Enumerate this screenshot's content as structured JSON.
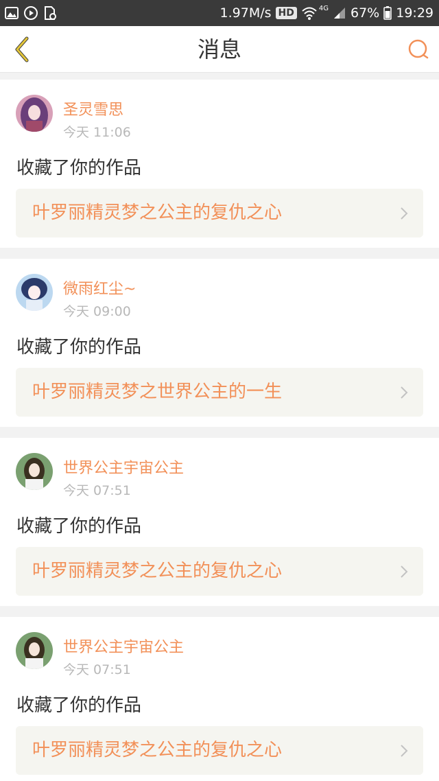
{
  "status_bar": {
    "speed": "1.97M/s",
    "hd": "HD",
    "network": "4G",
    "battery": "67%",
    "time": "19:29"
  },
  "header": {
    "title": "消息"
  },
  "colors": {
    "accent": "#f29058",
    "back_icon": "#e2c53a",
    "text_primary": "#333333",
    "text_muted": "#b8b8b8",
    "link_bg": "#f5f5f0"
  },
  "icons": {
    "back": "chevron-left-icon",
    "search": "search-icon",
    "link_arrow": "chevron-right-icon"
  },
  "messages": [
    {
      "username": "圣灵雪思",
      "time": "今天 11:06",
      "action": "收藏了你的作品",
      "work": "叶罗丽精灵梦之公主的复仇之心"
    },
    {
      "username": "微雨红尘~",
      "time": "今天 09:00",
      "action": "收藏了你的作品",
      "work": "叶罗丽精灵梦之世界公主的一生"
    },
    {
      "username": "世界公主宇宙公主",
      "time": "今天 07:51",
      "action": "收藏了你的作品",
      "work": "叶罗丽精灵梦之公主的复仇之心"
    },
    {
      "username": "世界公主宇宙公主",
      "time": "今天 07:51",
      "action": "收藏了你的作品",
      "work": "叶罗丽精灵梦之公主的复仇之心"
    }
  ]
}
